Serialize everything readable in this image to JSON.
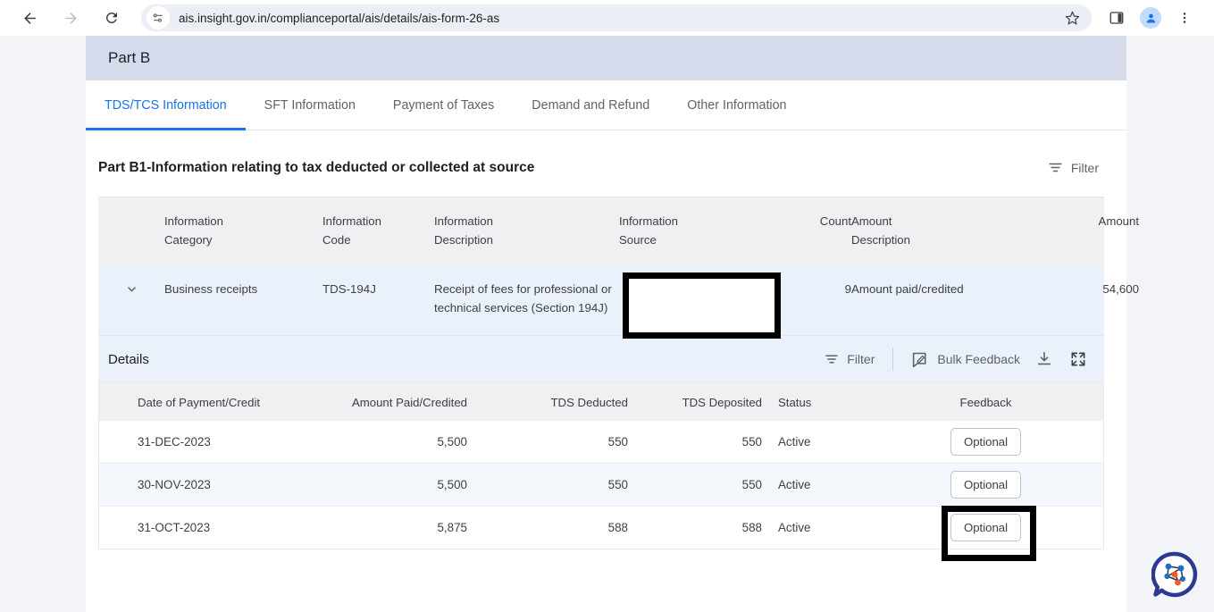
{
  "browser": {
    "url": "ais.insight.gov.in/complianceportal/ais/details/ais-form-26-as",
    "back_icon": "back-arrow-icon",
    "forward_icon": "forward-arrow-icon",
    "reload_icon": "reload-icon",
    "site_info_icon": "site-settings-icon",
    "bookmark_icon": "star-icon",
    "sidepanel_icon": "side-panel-icon",
    "profile_icon": "profile-avatar-icon",
    "menu_icon": "three-dot-menu-icon"
  },
  "page": {
    "header_title": "Part B",
    "tabs": [
      {
        "label": "TDS/TCS Information",
        "active": true
      },
      {
        "label": "SFT Information",
        "active": false
      },
      {
        "label": "Payment of Taxes",
        "active": false
      },
      {
        "label": "Demand and Refund",
        "active": false
      },
      {
        "label": "Other Information",
        "active": false
      }
    ],
    "section": {
      "title": "Part B1-Information relating to tax deducted or collected at source",
      "filter_label": "Filter"
    },
    "outer_table": {
      "headers": {
        "category": "Information\nCategory",
        "category_l1": "Information",
        "category_l2": "Category",
        "code_l1": "Information",
        "code_l2": "Code",
        "description_l1": "Information",
        "description_l2": "Description",
        "source_l1": "Information",
        "source_l2": "Source",
        "count": "Count",
        "amount_desc_l1": "Amount",
        "amount_desc_l2": "Description",
        "amount": "Amount"
      },
      "row": {
        "expand_icon": "chevron-down-icon",
        "category": "Business receipts",
        "code": "TDS-194J",
        "description": "Receipt of fees for professional or technical services (Section 194J)",
        "source": "",
        "count": "9",
        "amount_description": "Amount paid/credited",
        "amount": "54,600"
      }
    },
    "details": {
      "title": "Details",
      "filter_label": "Filter",
      "bulk_feedback_label": "Bulk Feedback",
      "download_icon": "download-icon",
      "expand_icon": "fullscreen-expand-icon",
      "headers": [
        "Date of Payment/Credit",
        "Amount Paid/Credited",
        "TDS Deducted",
        "TDS Deposited",
        "Status",
        "Feedback"
      ],
      "rows": [
        {
          "date": "31-DEC-2023",
          "amount_paid": "5,500",
          "tds_deducted": "550",
          "tds_deposited": "550",
          "status": "Active",
          "feedback": "Optional"
        },
        {
          "date": "30-NOV-2023",
          "amount_paid": "5,500",
          "tds_deducted": "550",
          "tds_deposited": "550",
          "status": "Active",
          "feedback": "Optional"
        },
        {
          "date": "31-OCT-2023",
          "amount_paid": "5,875",
          "tds_deducted": "588",
          "tds_deposited": "588",
          "status": "Active",
          "feedback": "Optional"
        }
      ]
    },
    "chat_widget": {
      "icon": "chat-network-bubble-icon"
    },
    "colors": {
      "accent": "#1a73e8",
      "header_band": "#d6dbeb",
      "table_header": "#f0f0f3",
      "row_highlight": "#eaf1fb",
      "page_bg": "#f3f4f8",
      "highlight_box": "#000000"
    }
  }
}
